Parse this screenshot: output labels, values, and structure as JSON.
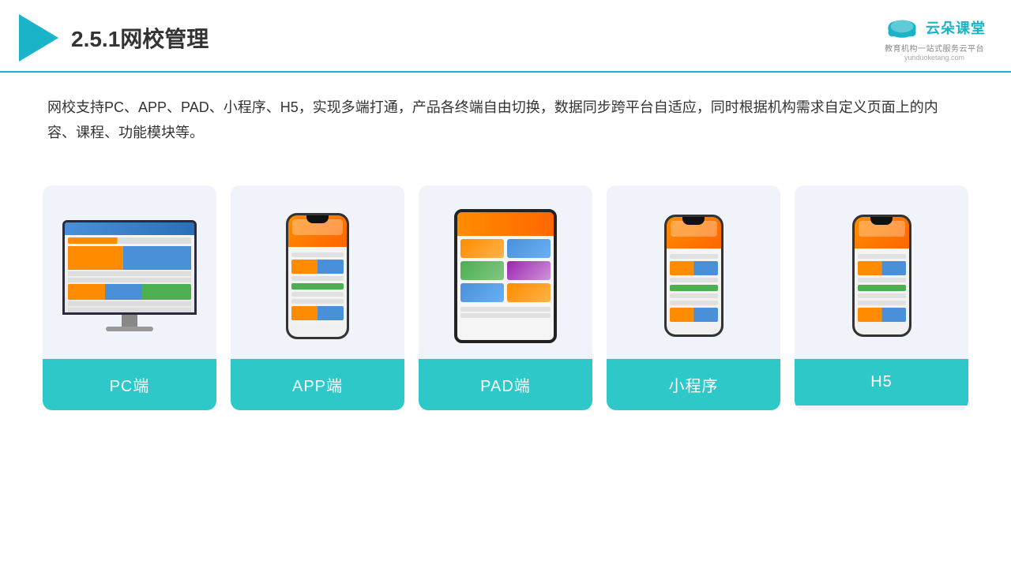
{
  "header": {
    "title": "2.5.1网校管理",
    "logo_name": "云朵课堂",
    "logo_url": "yunduoketang.com",
    "logo_tagline": "教育机构一站\n式服务云平台"
  },
  "description": {
    "text": "网校支持PC、APP、PAD、小程序、H5，实现多端打通，产品各终端自由切换，数据同步跨平台自适应，同时根据机构需求自定义页面上的内容、课程、功能模块等。"
  },
  "cards": [
    {
      "id": "pc",
      "label": "PC端"
    },
    {
      "id": "app",
      "label": "APP端"
    },
    {
      "id": "pad",
      "label": "PAD端"
    },
    {
      "id": "miniprogram",
      "label": "小程序"
    },
    {
      "id": "h5",
      "label": "H5"
    }
  ]
}
